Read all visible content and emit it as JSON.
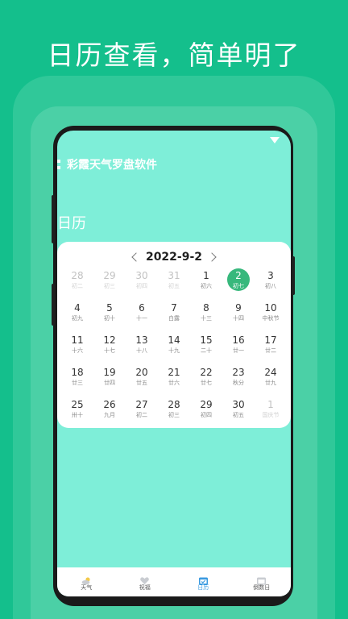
{
  "headline": "日历查看，简单明了",
  "app": {
    "title": "彩霞天气罗盘软件",
    "section_title": "日历"
  },
  "calendar": {
    "title": "2022-9-2",
    "days": [
      {
        "num": "28",
        "lunar": "初二",
        "muted": true
      },
      {
        "num": "29",
        "lunar": "初三",
        "muted": true
      },
      {
        "num": "30",
        "lunar": "初四",
        "muted": true
      },
      {
        "num": "31",
        "lunar": "初五",
        "muted": true
      },
      {
        "num": "1",
        "lunar": "初六",
        "muted": false
      },
      {
        "num": "2",
        "lunar": "初七",
        "muted": false,
        "selected": true
      },
      {
        "num": "3",
        "lunar": "初八",
        "muted": false
      },
      {
        "num": "4",
        "lunar": "初九",
        "muted": false
      },
      {
        "num": "5",
        "lunar": "初十",
        "muted": false
      },
      {
        "num": "6",
        "lunar": "十一",
        "muted": false
      },
      {
        "num": "7",
        "lunar": "白露",
        "muted": false
      },
      {
        "num": "8",
        "lunar": "十三",
        "muted": false
      },
      {
        "num": "9",
        "lunar": "十四",
        "muted": false
      },
      {
        "num": "10",
        "lunar": "中秋节",
        "muted": false
      },
      {
        "num": "11",
        "lunar": "十六",
        "muted": false
      },
      {
        "num": "12",
        "lunar": "十七",
        "muted": false
      },
      {
        "num": "13",
        "lunar": "十八",
        "muted": false
      },
      {
        "num": "14",
        "lunar": "十九",
        "muted": false
      },
      {
        "num": "15",
        "lunar": "二十",
        "muted": false
      },
      {
        "num": "16",
        "lunar": "廿一",
        "muted": false
      },
      {
        "num": "17",
        "lunar": "廿二",
        "muted": false
      },
      {
        "num": "18",
        "lunar": "廿三",
        "muted": false
      },
      {
        "num": "19",
        "lunar": "廿四",
        "muted": false
      },
      {
        "num": "20",
        "lunar": "廿五",
        "muted": false
      },
      {
        "num": "21",
        "lunar": "廿六",
        "muted": false
      },
      {
        "num": "22",
        "lunar": "廿七",
        "muted": false
      },
      {
        "num": "23",
        "lunar": "秋分",
        "muted": false
      },
      {
        "num": "24",
        "lunar": "廿九",
        "muted": false
      },
      {
        "num": "25",
        "lunar": "卅十",
        "muted": false
      },
      {
        "num": "26",
        "lunar": "九月",
        "muted": false
      },
      {
        "num": "27",
        "lunar": "初二",
        "muted": false
      },
      {
        "num": "28",
        "lunar": "初三",
        "muted": false
      },
      {
        "num": "29",
        "lunar": "初四",
        "muted": false
      },
      {
        "num": "30",
        "lunar": "初五",
        "muted": false
      },
      {
        "num": "1",
        "lunar": "国庆节",
        "muted": true
      }
    ]
  },
  "tabs": [
    {
      "label": "天气",
      "icon": "weather-icon",
      "active": false
    },
    {
      "label": "祝福",
      "icon": "blessing-icon",
      "active": false
    },
    {
      "label": "日历",
      "icon": "calendar-icon",
      "active": true
    },
    {
      "label": "倒数日",
      "icon": "countdown-icon",
      "active": false
    }
  ],
  "colors": {
    "background": "#14bf8c",
    "screen": "#7eeed8",
    "selected": "#37b87c",
    "active_tab": "#3a9ae0"
  }
}
